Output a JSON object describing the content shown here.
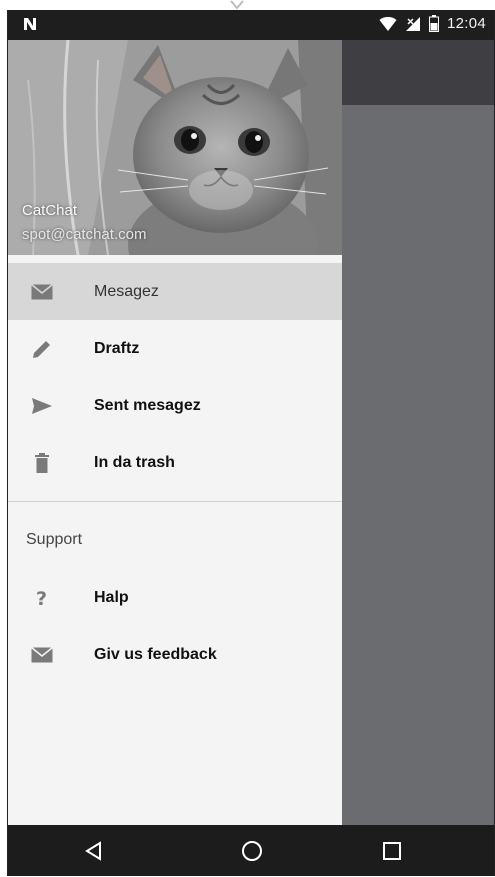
{
  "status_bar": {
    "time": "12:04"
  },
  "drawer": {
    "header": {
      "name": "CatChat",
      "email": "spot@catchat.com"
    },
    "items": [
      {
        "label": "Mesagez",
        "icon": "mail-icon",
        "active": true
      },
      {
        "label": "Draftz",
        "icon": "pencil-icon",
        "active": false
      },
      {
        "label": "Sent mesagez",
        "icon": "send-icon",
        "active": false
      },
      {
        "label": "In da trash",
        "icon": "trash-icon",
        "active": false
      }
    ],
    "support": {
      "title": "Support",
      "items": [
        {
          "label": "Halp",
          "icon": "help-icon"
        },
        {
          "label": "Giv us feedback",
          "icon": "mail-icon"
        }
      ]
    }
  },
  "nav_bar": {
    "buttons": [
      "back-icon",
      "home-icon",
      "recents-icon"
    ]
  },
  "colors": {
    "status_bar": "#1e1e1e",
    "drawer_bg": "#f4f4f4",
    "active_item": "#d7d7d7",
    "scrim": "#6b6c70",
    "nav_bar": "#1c1c1c"
  }
}
